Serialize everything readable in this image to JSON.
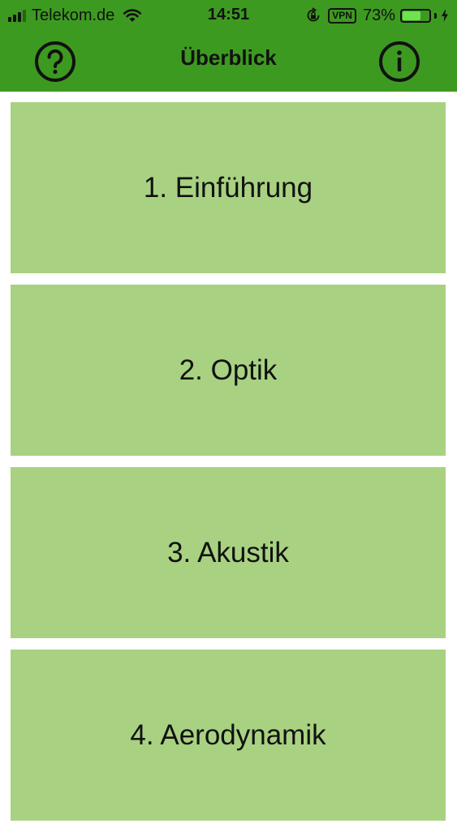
{
  "status_bar": {
    "carrier": "Telekom.de",
    "time": "14:51",
    "vpn": "VPN",
    "battery_percent": "73%",
    "battery_level": 0.73
  },
  "nav": {
    "title": "Überblick",
    "left_icon": "help-circle-icon",
    "right_icon": "info-circle-icon"
  },
  "colors": {
    "header": "#3d9a20",
    "tile": "#a8d281",
    "battery": "#6fe24f"
  },
  "tiles": [
    {
      "label": "1. Einführung"
    },
    {
      "label": "2. Optik"
    },
    {
      "label": "3. Akustik"
    },
    {
      "label": "4. Aerodynamik"
    }
  ]
}
